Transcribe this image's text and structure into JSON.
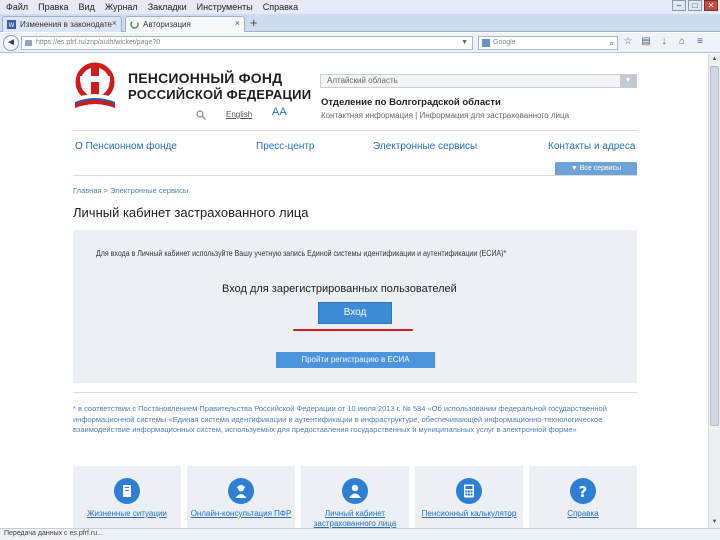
{
  "browser": {
    "menu": [
      "Файл",
      "Правка",
      "Вид",
      "Журнал",
      "Закладки",
      "Инструменты",
      "Справка"
    ],
    "tabs": [
      {
        "label": "Изменения в законодательстве о..."
      },
      {
        "label": "Авторизация"
      }
    ],
    "url": "https://es.pfrf.ru/znp/auth/wicket/page?0",
    "search_placeholder": "Google",
    "status": "Передача данных с es.pfrf.ru..."
  },
  "header": {
    "org_line1": "ПЕНСИОННЫЙ ФОНД",
    "org_line2": "РОССИЙСКОЙ ФЕДЕРАЦИИ",
    "english_link": "English",
    "font_size_control": "AA",
    "region_select": "Алтайский область",
    "branch_title": "Отделение по Волгоградской области",
    "branch_links": "Контактная информация | Информация для застрахованного лица"
  },
  "main_menu": [
    "О Пенсионном фонде",
    "Пресс-центр",
    "Электронные сервисы",
    "Контакты и адреса"
  ],
  "all_services_tab": "Все сервисы",
  "breadcrumb": "Главная > Электронные сервисы",
  "page_title": "Личный кабинет застрахованного лица",
  "login": {
    "note": "Для входа в Личный кабинет используйте Вашу учетную запись Единой системы идентификации и аутентификации (ЕСИА)*",
    "heading": "Вход для зарегистрированных пользователей",
    "login_button": "Вход",
    "register_button": "Пройти регистрацию в ЕСИА"
  },
  "footnote": "* в соответствии с Постановлением Правительства Российской Федерации от 10 июля 2013 г. № 584 «Об использовании федеральной государственной информационной системы «Единая система идентификации и аутентификации в инфраструктуре, обеспечивающей информационно-технологическое взаимодействие информационных систем, используемых для предоставления государственных и муниципальных услуг в электронной форме»",
  "tiles": [
    {
      "label": "Жизненные ситуации",
      "icon": "document-icon"
    },
    {
      "label": "Онлайн-консультация ПФР",
      "icon": "consultant-icon"
    },
    {
      "label": "Личный кабинет застрахованного лица",
      "icon": "user-icon"
    },
    {
      "label": "Пенсионный калькулятор",
      "icon": "calculator-icon"
    },
    {
      "label": "Справка",
      "icon": "question-icon"
    }
  ],
  "colors": {
    "link_blue": "#2a6fb8",
    "button_blue": "#3c8cd6",
    "logo_red": "#d21b1b",
    "box_gray": "#ecf0f5"
  }
}
